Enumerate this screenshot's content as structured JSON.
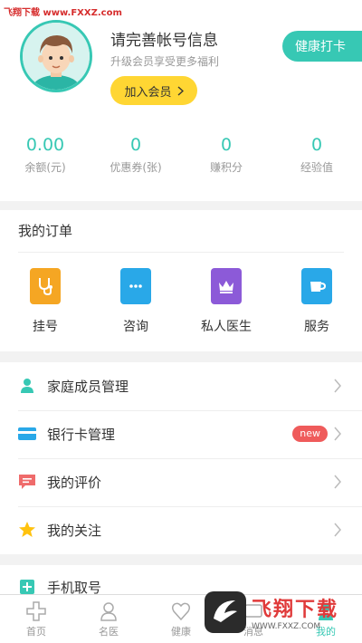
{
  "watermark_top": "飞翔下载 www.FXXZ.com",
  "user": {
    "title": "请完善帐号信息",
    "subtitle": "升级会员享受更多福利",
    "member_btn": "加入会员"
  },
  "checkin_btn": "健康打卡",
  "stats": [
    {
      "value": "0.00",
      "label": "余额(元)"
    },
    {
      "value": "0",
      "label": "优惠券(张)"
    },
    {
      "value": "0",
      "label": "赚积分"
    },
    {
      "value": "0",
      "label": "经验值"
    }
  ],
  "orders": {
    "title": "我的订单",
    "items": [
      {
        "label": "挂号",
        "icon": "stethoscope-icon",
        "color": "#f5a623"
      },
      {
        "label": "咨询",
        "icon": "chat-bubble-icon",
        "color": "#29a8e8"
      },
      {
        "label": "私人医生",
        "icon": "crown-icon",
        "color": "#8c5ad8"
      },
      {
        "label": "服务",
        "icon": "cup-icon",
        "color": "#29a8e8"
      }
    ]
  },
  "menu": [
    {
      "label": "家庭成员管理",
      "icon": "person-icon",
      "color": "#37c8b4"
    },
    {
      "label": "银行卡管理",
      "icon": "card-icon",
      "color": "#29a8e8",
      "badge": "new"
    },
    {
      "label": "我的评价",
      "icon": "comment-icon",
      "color": "#ef6b6b"
    },
    {
      "label": "我的关注",
      "icon": "star-icon",
      "color": "#ffc20e"
    }
  ],
  "menu2": [
    {
      "label": "手机取号",
      "icon": "phone-ticket-icon",
      "color": "#37c8b4"
    }
  ],
  "tabs": [
    {
      "label": "首页",
      "icon": "home-cross-icon"
    },
    {
      "label": "名医",
      "icon": "doctor-icon"
    },
    {
      "label": "健康",
      "icon": "heart-icon"
    },
    {
      "label": "消息",
      "icon": "message-icon"
    },
    {
      "label": "我的",
      "icon": "me-icon",
      "active": true
    }
  ],
  "watermark_bottom": {
    "main": "飞翔下载",
    "url": "WWW.FXXZ.COM"
  },
  "colors": {
    "accent": "#37c8b4",
    "member": "#ffd633",
    "badge": "#ef5b5b"
  }
}
